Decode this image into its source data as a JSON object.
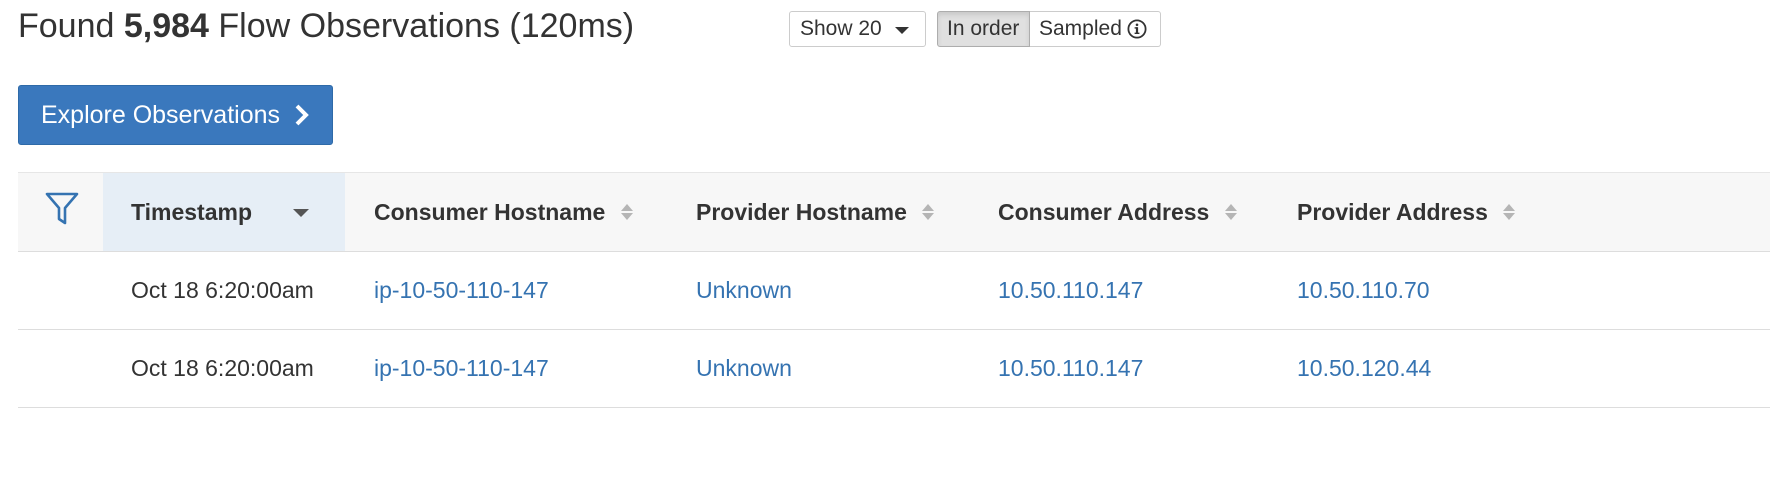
{
  "header": {
    "found_prefix": "Found",
    "count": "5,984",
    "found_suffix": "Flow Observations (120ms)"
  },
  "controls": {
    "show_label": "Show 20",
    "toggle": {
      "in_order": "In order",
      "sampled": "Sampled",
      "active": "In order"
    }
  },
  "explore_button": {
    "label": "Explore Observations"
  },
  "table": {
    "columns": [
      "Timestamp",
      "Consumer Hostname",
      "Provider Hostname",
      "Consumer Address",
      "Provider Address"
    ],
    "sorted_column": "Timestamp",
    "sort_direction": "descending",
    "rows": [
      {
        "timestamp": "Oct 18 6:20:00am",
        "consumer_hostname": "ip-10-50-110-147",
        "provider_hostname": "Unknown",
        "consumer_address": "10.50.110.147",
        "provider_address": "10.50.110.70"
      },
      {
        "timestamp": "Oct 18 6:20:00am",
        "consumer_hostname": "ip-10-50-110-147",
        "provider_hostname": "Unknown",
        "consumer_address": "10.50.110.147",
        "provider_address": "10.50.120.44"
      }
    ]
  },
  "colors": {
    "primary_button": "#3a78bd",
    "link": "#3573b1",
    "sorted_header_bg": "#e6eef6",
    "filter_icon": "#3573b1"
  },
  "icons": {
    "filter": "filter-icon",
    "info": "info-icon",
    "chevron": "chevron-right-icon",
    "caret": "caret-down-icon",
    "sort": "sort-icon"
  }
}
